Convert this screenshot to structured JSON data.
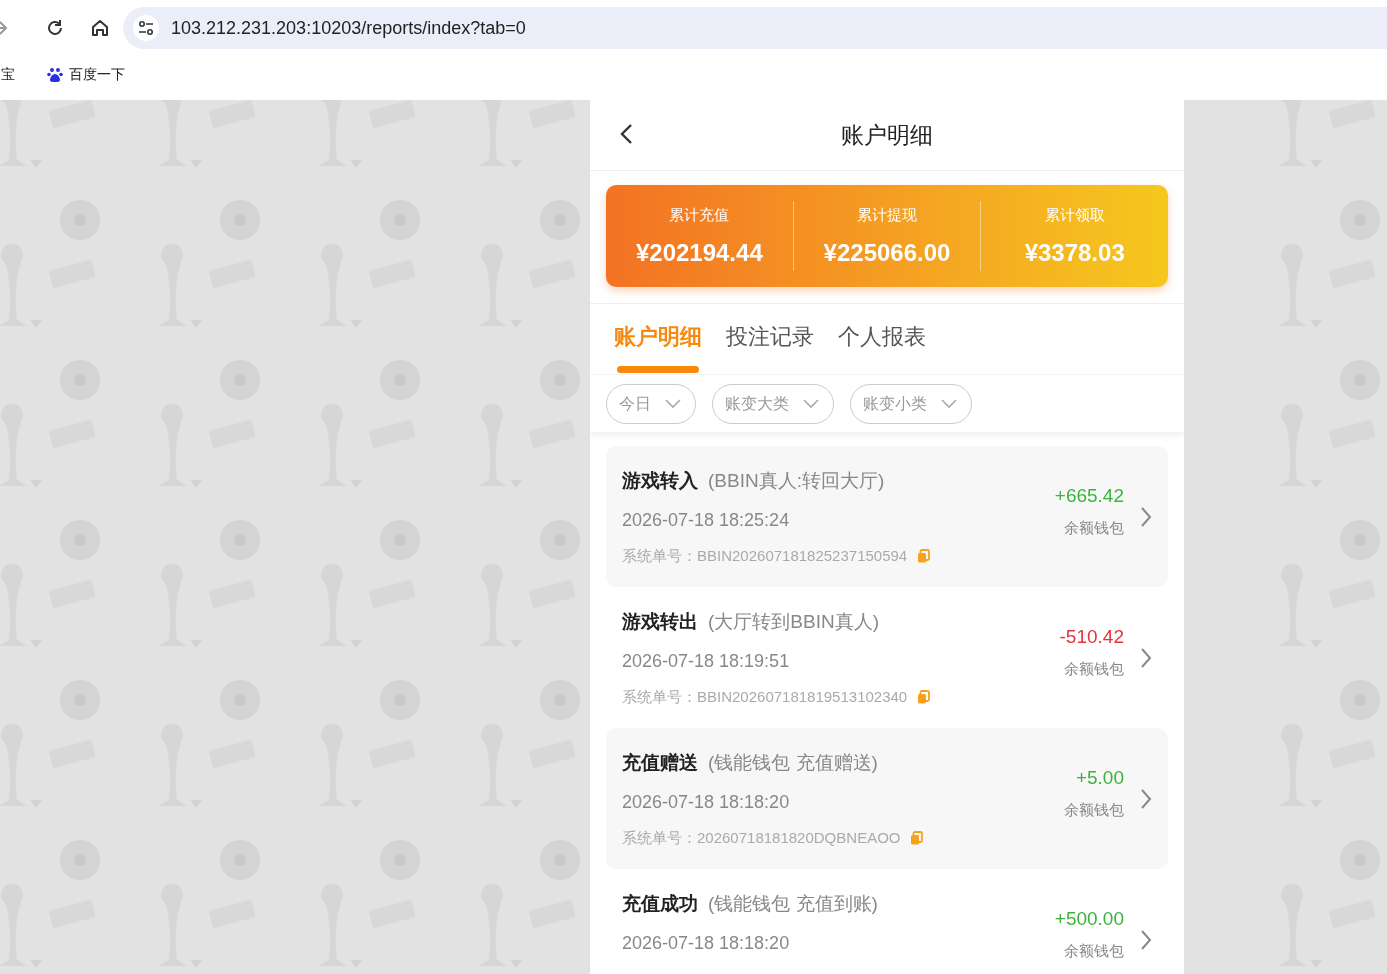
{
  "browser": {
    "url": "103.212.231.203:10203/reports/index?tab=0",
    "bookmarks": [
      {
        "label": "宝",
        "kind": "text"
      },
      {
        "label": "百度一下",
        "kind": "site"
      }
    ]
  },
  "header": {
    "title": "账户明细"
  },
  "summary": [
    {
      "label": "累计充值",
      "value": "¥202194.44"
    },
    {
      "label": "累计提现",
      "value": "¥225066.00"
    },
    {
      "label": "累计领取",
      "value": "¥3378.03"
    }
  ],
  "tabs": [
    {
      "label": "账户明细",
      "selected": true
    },
    {
      "label": "投注记录",
      "selected": false
    },
    {
      "label": "个人报表",
      "selected": false
    }
  ],
  "filters": [
    {
      "label": "今日"
    },
    {
      "label": "账变大类"
    },
    {
      "label": "账变小类"
    }
  ],
  "records": [
    {
      "title": "游戏转入",
      "note": "(BBIN真人:转回大厅)",
      "time": "2026-07-18 18:25:24",
      "order_label": "系统单号：",
      "order_no": "BBIN202607181825237150594",
      "amount": "+665.42",
      "color": "#3cb43c",
      "wallet": "余额钱包"
    },
    {
      "title": "游戏转出",
      "note": "(大厅转到BBIN真人)",
      "time": "2026-07-18 18:19:51",
      "order_label": "系统单号：",
      "order_no": "BBIN202607181819513102340",
      "amount": "-510.42",
      "color": "#e0353b",
      "wallet": "余额钱包"
    },
    {
      "title": "充值赠送",
      "note": "(钱能钱包 充值赠送)",
      "time": "2026-07-18 18:18:20",
      "order_label": "系统单号：",
      "order_no": "20260718181820DQBNEAOO",
      "amount": "+5.00",
      "color": "#3cb43c",
      "wallet": "余额钱包"
    },
    {
      "title": "充值成功",
      "note": "(钱能钱包 充值到账)",
      "time": "2026-07-18 18:18:20",
      "amount": "+500.00",
      "color": "#3cb43c",
      "wallet": "余额钱包"
    }
  ]
}
